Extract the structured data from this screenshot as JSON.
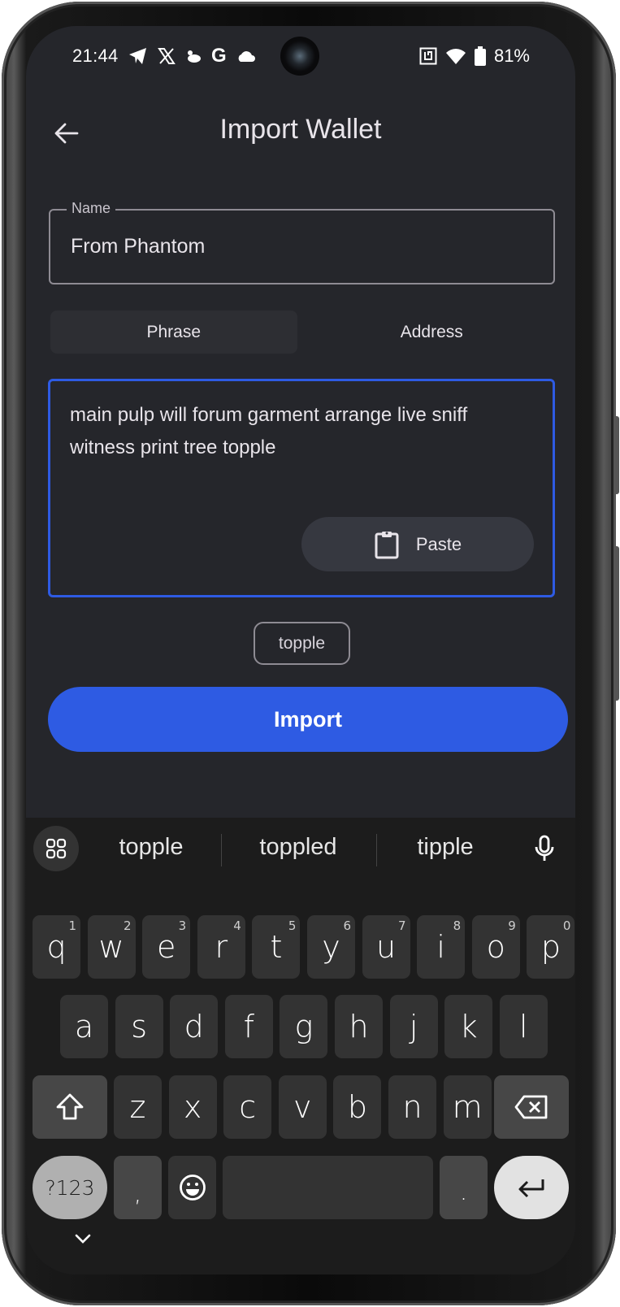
{
  "status_bar": {
    "time": "21:44",
    "left_icons": [
      "telegram-icon",
      "x-icon",
      "bird-icon",
      "google-icon",
      "cloud-icon"
    ],
    "right_icons": [
      "nfc-icon",
      "wifi-icon",
      "battery-icon"
    ],
    "battery_percent": "81%"
  },
  "header": {
    "title": "Import Wallet",
    "back_icon": "arrow-left-icon"
  },
  "form": {
    "name_label": "Name",
    "name_value": "From Phantom",
    "tabs": [
      {
        "label": "Phrase",
        "active": true
      },
      {
        "label": "Address",
        "active": false
      }
    ],
    "phrase_value": "main pulp will forum garment arrange live sniff witness print tree topple",
    "paste_label": "Paste",
    "suggestion_chip": "topple",
    "import_label": "Import"
  },
  "colors": {
    "accent": "#2e5be3",
    "background": "#25262b",
    "keyboard_bg": "#1c1c1c"
  },
  "keyboard": {
    "suggestions": [
      "topple",
      "toppled",
      "tipple"
    ],
    "row1": [
      {
        "k": "q",
        "h": "1"
      },
      {
        "k": "w",
        "h": "2"
      },
      {
        "k": "e",
        "h": "3"
      },
      {
        "k": "r",
        "h": "4"
      },
      {
        "k": "t",
        "h": "5"
      },
      {
        "k": "y",
        "h": "6"
      },
      {
        "k": "u",
        "h": "7"
      },
      {
        "k": "i",
        "h": "8"
      },
      {
        "k": "o",
        "h": "9"
      },
      {
        "k": "p",
        "h": "0"
      }
    ],
    "row2": [
      "a",
      "s",
      "d",
      "f",
      "g",
      "h",
      "j",
      "k",
      "l"
    ],
    "row3": [
      "z",
      "x",
      "c",
      "v",
      "b",
      "n",
      "m"
    ],
    "symbols_label": "?123",
    "comma": ",",
    "period": "."
  }
}
